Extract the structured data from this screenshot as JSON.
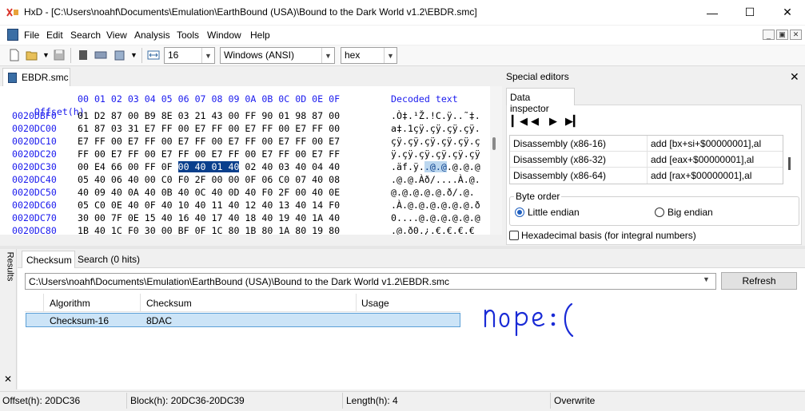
{
  "window": {
    "title": "HxD - [C:\\Users\\noahf\\Documents\\Emulation\\EarthBound (USA)\\Bound to the Dark World v1.2\\EBDR.smc]",
    "minimize_icon": "minimize-icon",
    "maximize_icon": "maximize-icon",
    "close_icon": "close-icon"
  },
  "menu": [
    "File",
    "Edit",
    "Search",
    "View",
    "Analysis",
    "Tools",
    "Window",
    "Help"
  ],
  "toolbar": {
    "bytes_per_row": "16",
    "charset": "Windows (ANSI)",
    "offset_base": "hex"
  },
  "editor": {
    "tab_label": "EBDR.smc",
    "header_offset": "Offset(h)",
    "header_cols": "00 01 02 03 04 05 06 07 08 09 0A 0B 0C 0D 0E 0F",
    "header_decoded": "Decoded text",
    "rows": [
      {
        "offset": "0020DBF0",
        "hex": "01 D2 87 00 B9 8E 03 21 43 00 FF 90 01 98 87 00",
        "text": ".Ò‡.¹Ž.!C.ÿ..˜‡."
      },
      {
        "offset": "0020DC00",
        "hex": "61 87 03 31 E7 FF 00 E7 FF 00 E7 FF 00 E7 FF 00",
        "text": "a‡.1çÿ.çÿ.çÿ.çÿ."
      },
      {
        "offset": "0020DC10",
        "hex": "E7 FF 00 E7 FF 00 E7 FF 00 E7 FF 00 E7 FF 00 E7",
        "text": "çÿ.çÿ.çÿ.çÿ.çÿ.ç"
      },
      {
        "offset": "0020DC20",
        "hex": "FF 00 E7 FF 00 E7 FF 00 E7 FF 00 E7 FF 00 E7 FF",
        "text": "ÿ.çÿ.çÿ.çÿ.çÿ.çÿ"
      },
      {
        "offset": "0020DC30",
        "hex_pre": "00 E4 66 00 FF 0F ",
        "hex_sel": "00 40 01 40",
        "hex_post": " 02 40 03 40 04 40",
        "text_pre": ".äf.ÿ.",
        "text_sel": ".@.@",
        "text_post": ".@.@.@"
      },
      {
        "offset": "0020DC40",
        "hex": "05 40 06 40 00 C0 F0 2F 00 00 0F 06 C0 07 40 08",
        "text": ".@.@.Àð/....À.@."
      },
      {
        "offset": "0020DC50",
        "hex": "40 09 40 0A 40 0B 40 0C 40 0D 40 F0 2F 00 40 0E",
        "text": "@.@.@.@.@.ð/.@."
      },
      {
        "offset": "0020DC60",
        "hex": "05 C0 0E 40 0F 40 10 40 11 40 12 40 13 40 14 F0",
        "text": ".À.@.@.@.@.@.@.ð"
      },
      {
        "offset": "0020DC70",
        "hex": "30 00 7F 0E 15 40 16 40 17 40 18 40 19 40 1A 40",
        "text": "0....@.@.@.@.@.@"
      },
      {
        "offset": "0020DC80",
        "hex": "1B 40 1C F0 30 00 BF 0F 1C 80 1B 80 1A 80 19 80",
        "text": ".@.ð0.¿.€.€.€.€"
      }
    ]
  },
  "special_editors": {
    "title": "Special editors",
    "tab": "Data inspector",
    "rows": [
      {
        "type": "Disassembly (x86-16)",
        "value": "add [bx+si+$00000001],al"
      },
      {
        "type": "Disassembly (x86-32)",
        "value": "add [eax+$00000001],al"
      },
      {
        "type": "Disassembly (x86-64)",
        "value": "add [rax+$00000001],al"
      }
    ],
    "byte_order_label": "Byte order",
    "little_endian": "Little endian",
    "big_endian": "Big endian",
    "hex_basis": "Hexadecimal basis (for integral numbers)"
  },
  "results": {
    "side_label": "Results",
    "tab_checksum": "Checksum",
    "tab_search": "Search (0 hits)",
    "path": "C:\\Users\\noahf\\Documents\\Emulation\\EarthBound (USA)\\Bound to the Dark World v1.2\\EBDR.smc",
    "refresh": "Refresh",
    "columns": [
      "Algorithm",
      "Checksum",
      "Usage"
    ],
    "row": {
      "algorithm": "Checksum-16",
      "checksum": "8DAC",
      "usage": ""
    },
    "annotation": "nope :("
  },
  "status": {
    "offset": "Offset(h): 20DC36",
    "block": "Block(h): 20DC36-20DC39",
    "length": "Length(h): 4",
    "mode": "Overwrite"
  }
}
